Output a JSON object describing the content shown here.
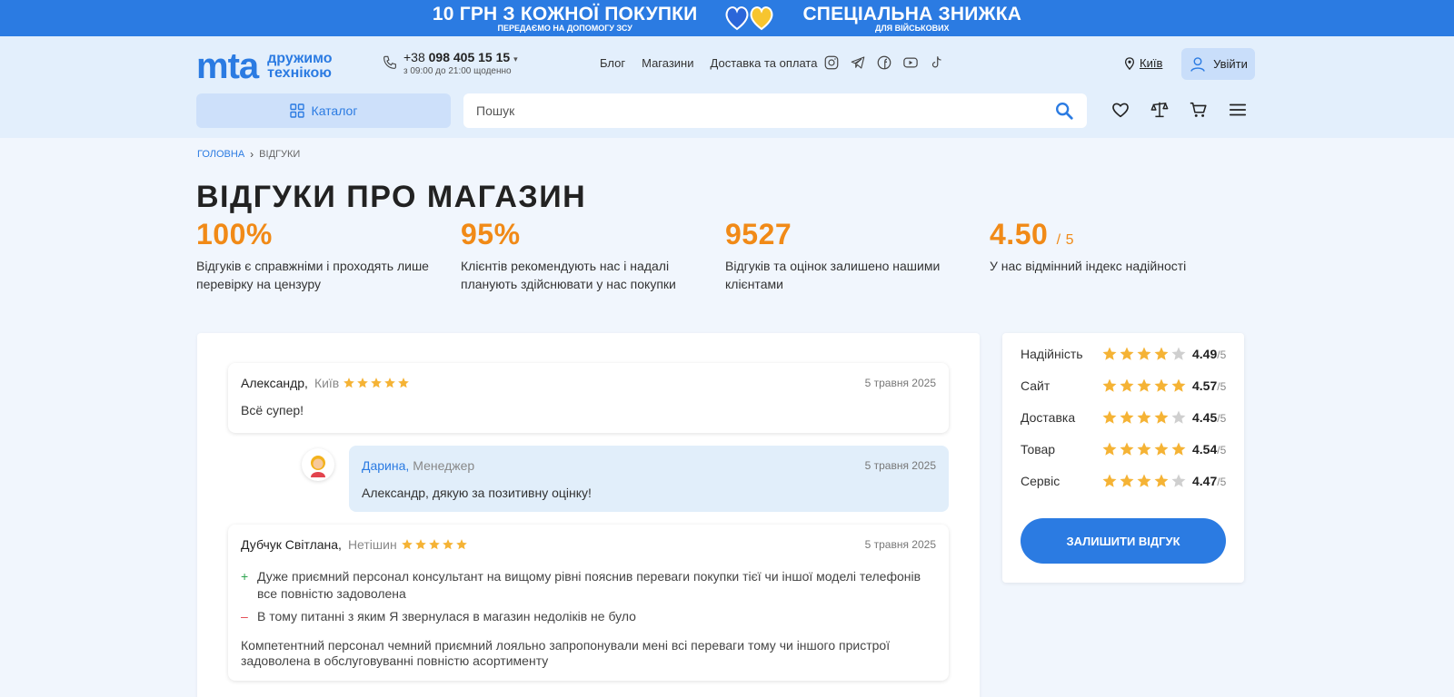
{
  "promo": {
    "left_main": "10 ГРН З КОЖНОЇ ПОКУПКИ",
    "left_sub": "ПЕРЕДАЄМО НА ДОПОМОГУ ЗСУ",
    "right_main": "СПЕЦІАЛЬНА ЗНИЖКА",
    "right_sub": "ДЛЯ ВІЙСЬКОВИХ"
  },
  "header": {
    "logo": "mta",
    "tagline_1": "дружимо",
    "tagline_2": "технікою",
    "phone_prefix": "+38",
    "phone_number": "098 405 15 15",
    "phone_hours": "з 09:00 до 21:00 щоденно",
    "nav": [
      "Блог",
      "Магазини",
      "Доставка та оплата"
    ],
    "socials": [
      "instagram-icon",
      "telegram-icon",
      "facebook-icon",
      "youtube-icon",
      "tiktok-icon"
    ],
    "city": "Київ",
    "login": "Увійти",
    "catalog": "Каталог",
    "search_placeholder": "Пошук"
  },
  "breadcrumb": {
    "home": "ГОЛОВНА",
    "current": "ВІДГУКИ"
  },
  "page_title": "ВІДГУКИ ПРО МАГАЗИН",
  "stats": [
    {
      "value": "100%",
      "suffix": "",
      "desc": "Відгуків є справжніми і проходять лише перевірку на цензуру"
    },
    {
      "value": "95%",
      "suffix": "",
      "desc": "Клієнтів рекомендують нас і надалі планують здійснювати у нас покупки"
    },
    {
      "value": "9527",
      "suffix": "",
      "desc": "Відгуків та оцінок залишено нашими клієнтами"
    },
    {
      "value": "4.50",
      "suffix": "/ 5",
      "desc": "У нас відмінний індекс надійності"
    }
  ],
  "reviews": [
    {
      "author": "Александр,",
      "city": "Київ",
      "stars": 5,
      "date": "5 травня 2025",
      "text": "Всё супер!",
      "reply": {
        "author": "Дарина,",
        "role": "Менеджер",
        "date": "5 травня 2025",
        "text": "Александр, дякую за позитивну оцінку!"
      }
    },
    {
      "author": "Дубчук Світлана,",
      "city": "Нетішин",
      "stars": 5,
      "date": "5 травня 2025",
      "pros_mark": "+",
      "pros": "Дуже приємний персонал консультант на вищому рівні пояснив переваги покупки тієї чи іншої моделі телефонів все повністю задоволена",
      "cons_mark": "–",
      "cons": "В тому питанні з яким Я звернулася в магазин недоліків не було",
      "text": "Компетентний персонал чемний приємний лояльно запропонували мені всі переваги тому чи іншого пристрої задоволена в обслуговуванні повністю асортименту"
    }
  ],
  "ratings": [
    {
      "label": "Надійність",
      "value": "4.49",
      "of": "/5",
      "full_stars": 4
    },
    {
      "label": "Сайт",
      "value": "4.57",
      "of": "/5",
      "full_stars": 5
    },
    {
      "label": "Доставка",
      "value": "4.45",
      "of": "/5",
      "full_stars": 4
    },
    {
      "label": "Товар",
      "value": "4.54",
      "of": "/5",
      "full_stars": 5
    },
    {
      "label": "Сервіс",
      "value": "4.47",
      "of": "/5",
      "full_stars": 4
    }
  ],
  "leave_review": "ЗАЛИШИТИ ВІДГУК",
  "colors": {
    "brand": "#2b7be2",
    "accent": "#f18a17",
    "star": "#f5b335",
    "star_empty": "#cfcfcf"
  }
}
